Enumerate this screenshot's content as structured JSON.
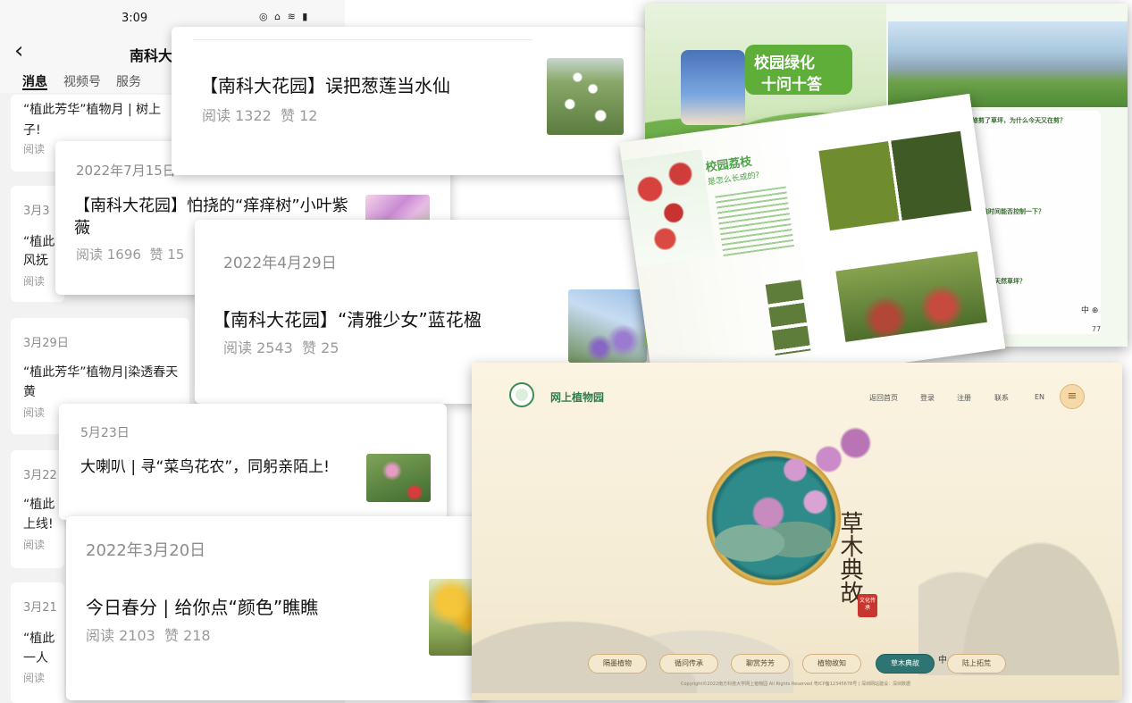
{
  "phone": {
    "status_time": "3:09",
    "status_icons": "◎ ⌂ ≋ ▮",
    "title": "南科大",
    "tabs": [
      "消息",
      "视频号",
      "服务"
    ],
    "back_icon": "‹",
    "bg_items": [
      {
        "text": "“植此芳华”植物月 | 树上",
        "extra": "子!",
        "stats": "阅读"
      },
      {
        "date": "3月3",
        "text": "“植此",
        "extra": "风抚",
        "stats": "阅读"
      },
      {
        "date": "3月29日",
        "text": "“植此芳华”植物月|染透春天",
        "extra": "黄",
        "stats": "阅读"
      },
      {
        "date": "3月22",
        "text": "“植此",
        "extra": "上线!",
        "stats": "阅读"
      },
      {
        "date": "3月21",
        "text": "“植此",
        "extra": "一人",
        "stats": "阅读"
      }
    ]
  },
  "cards": [
    {
      "date": "",
      "title": "【南科大花园】误把葱莲当水仙",
      "stats": "阅读 1322  赞 12"
    },
    {
      "date": "2022年7月15日",
      "title": "【南科大花园】怕挠的“痒痒树”小叶紫薇",
      "stats": "阅读 1696  赞 15"
    },
    {
      "date": "2022年4月29日",
      "title": "【南科大花园】“清雅少女”蓝花楹",
      "stats": "阅读 2543  赞 25"
    },
    {
      "date": "5月23日",
      "title": "大喇叭 | 寻“菜鸟花农”，同躬亲陌上!",
      "stats": ""
    },
    {
      "date": "2022年3月20日",
      "title": "今日春分 | 给你点“颜色”瞧瞧",
      "stats": "阅读 2103  赞 218"
    }
  ],
  "brochure1": {
    "badge_title": "校园绿化",
    "badge_sub": "十问十答",
    "question2": "新几天才修剪了草坪，为什么今天又在剪？",
    "question3": "新草坪铺设和种植时间能否控制一下？",
    "question4": "草坪刚刚修剪后？纯天然草坪？",
    "lang": "中 ⊕",
    "page_num": "77"
  },
  "brochure2": {
    "title": "校园荔枝",
    "subtitle": "是怎么长成的?"
  },
  "website": {
    "logo_text": "网上植物园",
    "nav": [
      "返回首页",
      "登录",
      "注册",
      "联系",
      "EN"
    ],
    "menu_icon": "≡",
    "calligraphy": "草木典故",
    "seal": "文化传承",
    "buttons": [
      "隔墨植物",
      "循问传承",
      "聊赏芳芳",
      "植物故知",
      "草木典故",
      "陆上拓荒"
    ],
    "lang": "中 ⊕",
    "footer": "Copyright©2022南方科技大学网上植物园 All Rights Reserved 粤ICP备12345678号 | 深圳网站建设：深圳数据"
  }
}
